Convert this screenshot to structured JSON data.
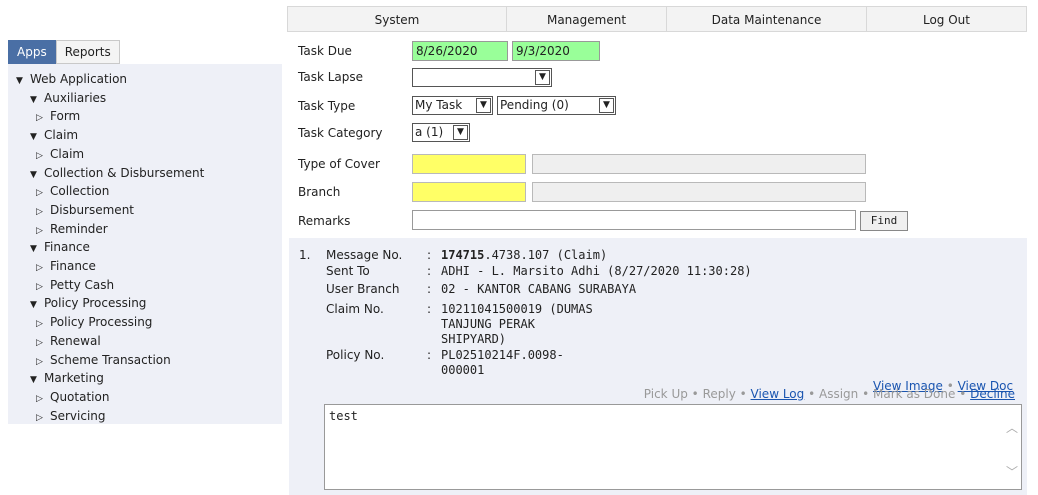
{
  "topmenu": [
    "System",
    "Management",
    "Data Maintenance",
    "Log Out"
  ],
  "tabs": [
    "Apps",
    "Reports"
  ],
  "tree": [
    {
      "label": "Web Application",
      "level": 0,
      "expanded": true
    },
    {
      "label": "Auxiliaries",
      "level": 1,
      "expanded": true
    },
    {
      "label": "Form",
      "level": 2,
      "expanded": false
    },
    {
      "label": "Claim",
      "level": 1,
      "expanded": true
    },
    {
      "label": "Claim",
      "level": 2,
      "expanded": false
    },
    {
      "label": "Collection & Disbursement",
      "level": 1,
      "expanded": true
    },
    {
      "label": "Collection",
      "level": 2,
      "expanded": false
    },
    {
      "label": "Disbursement",
      "level": 2,
      "expanded": false
    },
    {
      "label": "Reminder",
      "level": 2,
      "expanded": false
    },
    {
      "label": "Finance",
      "level": 1,
      "expanded": true
    },
    {
      "label": "Finance",
      "level": 2,
      "expanded": false
    },
    {
      "label": "Petty Cash",
      "level": 2,
      "expanded": false
    },
    {
      "label": "Policy Processing",
      "level": 1,
      "expanded": true
    },
    {
      "label": "Policy Processing",
      "level": 2,
      "expanded": false
    },
    {
      "label": "Renewal",
      "level": 2,
      "expanded": false
    },
    {
      "label": "Scheme Transaction",
      "level": 2,
      "expanded": false
    },
    {
      "label": "Marketing",
      "level": 1,
      "expanded": true
    },
    {
      "label": "Quotation",
      "level": 2,
      "expanded": false
    },
    {
      "label": "Servicing",
      "level": 2,
      "expanded": false
    }
  ],
  "form": {
    "task_due_label": "Task Due",
    "task_due_from": "8/26/2020",
    "task_due_sep": "-",
    "task_due_to": "9/3/2020",
    "task_lapse_label": "Task Lapse",
    "task_lapse_value": "",
    "task_type_label": "Task Type",
    "task_type_value": "My Task",
    "task_status_value": "Pending (0)",
    "task_category_label": "Task Category",
    "task_category_value": "a (1)",
    "cover_label": "Type of Cover",
    "branch_label": "Branch",
    "remarks_label": "Remarks",
    "find_label": "Find"
  },
  "message": {
    "index": "1.",
    "fields": [
      {
        "label": "Message No.",
        "lines": [
          "174715.4738.107 (Claim)"
        ],
        "bold_part": "174715"
      },
      {
        "label": "Sent To",
        "lines": [
          "ADHI - L. Marsito Adhi (8/27/2020 11:30:28)"
        ]
      },
      {
        "label": "User Branch",
        "lines": [
          "02 - KANTOR CABANG SURABAYA"
        ]
      },
      {
        "label": "Claim No.",
        "lines": [
          "10211041500019 (DUMAS",
          "TANJUNG PERAK",
          "SHIPYARD)"
        ]
      },
      {
        "label": "Policy No.",
        "lines": [
          "PL02510214F.0098-",
          "000001"
        ]
      }
    ],
    "rest_after_bold": ".4738.107 (Claim)",
    "colon": ":",
    "view_image": "View Image",
    "view_doc": "View Doc",
    "actions": [
      {
        "label": "Pick Up",
        "link": false
      },
      {
        "label": "Reply",
        "link": false
      },
      {
        "label": "View Log",
        "link": true
      },
      {
        "label": "Assign",
        "link": false
      },
      {
        "label": "Mark as Done",
        "link": false
      },
      {
        "label": "Decline",
        "link": true
      }
    ],
    "dot": "•",
    "note_text": "test"
  },
  "colors": {
    "tab_active": "#4a6fa5",
    "date_green": "#99ff99",
    "field_yellow": "#ffff66",
    "link": "#1a55b0",
    "panel_bg": "#eef0f7"
  }
}
